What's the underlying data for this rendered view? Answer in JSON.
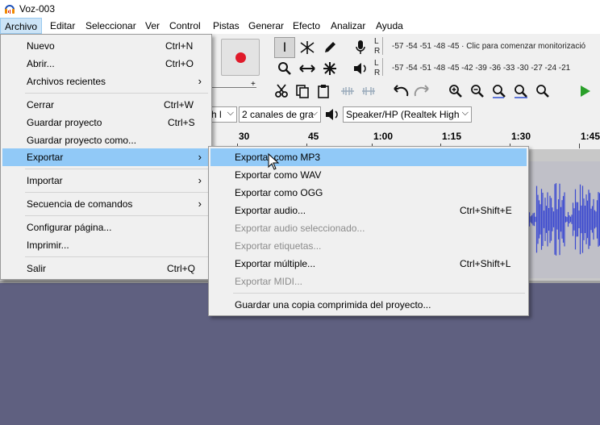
{
  "window": {
    "title": "Voz-003"
  },
  "menubar": {
    "items": [
      "Archivo",
      "Editar",
      "Seleccionar",
      "Ver",
      "Control",
      "Pistas",
      "Generar",
      "Efecto",
      "Analizar",
      "Ayuda"
    ]
  },
  "toolbar": {
    "meter_top": "-57 -54 -51 -48 -45 · Clic para comenzar monitorizació",
    "meter_bottom": "-57 -54 -51 -48 -45 -42 -39 -36 -33 -30 -27 -24 -21",
    "lr_left": "L",
    "lr_right": "R",
    "host_combo": "h l",
    "channels_combo": "2 canales de gra",
    "output_combo": "Speaker/HP (Realtek High"
  },
  "ruler": {
    "ticks": [
      "30",
      "45",
      "1:00",
      "1:15",
      "1:30",
      "1:45"
    ]
  },
  "archivo_menu": {
    "items": [
      {
        "label": "Nuevo",
        "shortcut": "Ctrl+N"
      },
      {
        "label": "Abrir...",
        "shortcut": "Ctrl+O"
      },
      {
        "label": "Archivos recientes",
        "submenu": true
      },
      {
        "label": "Cerrar",
        "shortcut": "Ctrl+W"
      },
      {
        "label": "Guardar proyecto",
        "shortcut": "Ctrl+S"
      },
      {
        "label": "Guardar proyecto como..."
      },
      {
        "label": "Exportar",
        "submenu": true,
        "highlighted": true
      },
      {
        "label": "Importar",
        "submenu": true
      },
      {
        "label": "Secuencia de comandos",
        "submenu": true
      },
      {
        "label": "Configurar página..."
      },
      {
        "label": "Imprimir..."
      },
      {
        "label": "Salir",
        "shortcut": "Ctrl+Q"
      }
    ]
  },
  "exportar_menu": {
    "items": [
      {
        "label": "Exportar como MP3",
        "highlighted": true
      },
      {
        "label": "Exportar como WAV"
      },
      {
        "label": "Exportar como OGG"
      },
      {
        "label": "Exportar audio...",
        "shortcut": "Ctrl+Shift+E"
      },
      {
        "label": "Exportar audio seleccionado...",
        "disabled": true
      },
      {
        "label": "Exportar etiquetas...",
        "disabled": true
      },
      {
        "label": "Exportar múltiple...",
        "shortcut": "Ctrl+Shift+L"
      },
      {
        "label": "Exportar MIDI...",
        "disabled": true
      },
      {
        "label": "Guardar una copia comprimida del proyecto..."
      }
    ]
  },
  "colors": {
    "highlight": "#91c9f7",
    "record": "#e01a2a",
    "waveform": "#3c4ad0",
    "background": "#5f6080"
  }
}
